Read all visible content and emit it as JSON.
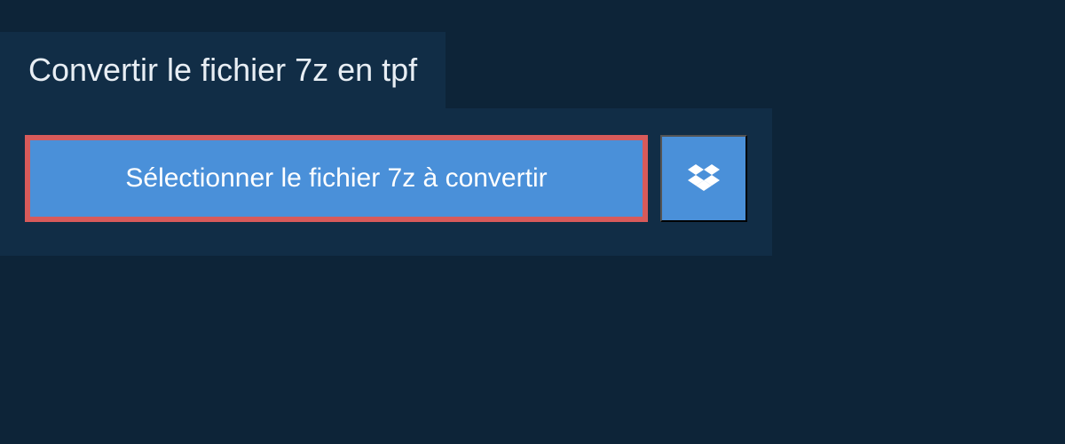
{
  "header": {
    "title": "Convertir le fichier 7z en tpf"
  },
  "actions": {
    "select_file_label": "Sélectionner le fichier 7z à convertir"
  },
  "colors": {
    "bg_dark": "#0d2438",
    "panel": "#112d46",
    "button_blue": "#4a90d9",
    "highlight_red": "#d85a5a",
    "text_light": "#e8eef4"
  }
}
